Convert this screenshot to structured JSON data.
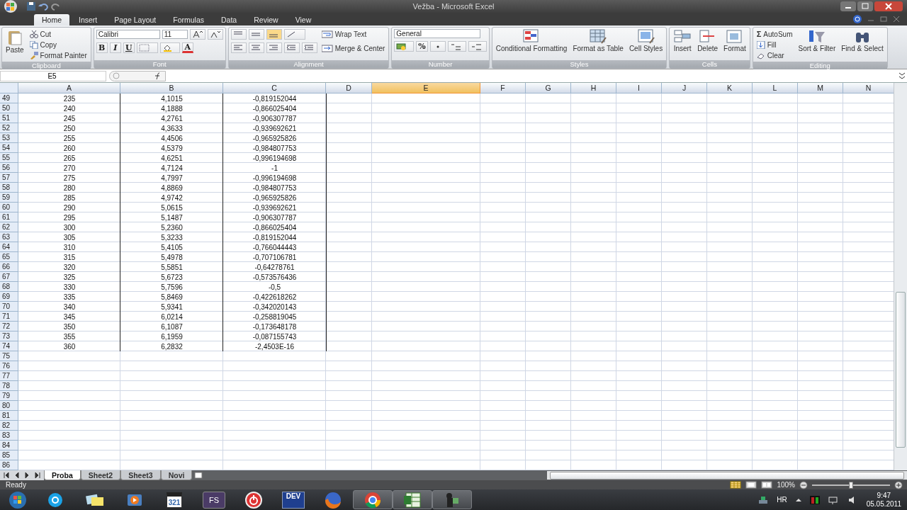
{
  "window": {
    "title": "Vežba - Microsoft Excel"
  },
  "ribbon_tabs": [
    {
      "label": "Home",
      "selected": true
    },
    {
      "label": "Insert",
      "selected": false
    },
    {
      "label": "Page Layout",
      "selected": false
    },
    {
      "label": "Formulas",
      "selected": false
    },
    {
      "label": "Data",
      "selected": false
    },
    {
      "label": "Review",
      "selected": false
    },
    {
      "label": "View",
      "selected": false
    }
  ],
  "ribbon_groups": [
    {
      "kind": "clipboard",
      "label": "Clipboard",
      "controls": [
        {
          "kind": "large",
          "label": "Paste"
        },
        {
          "kind": "small",
          "label": "Cut"
        },
        {
          "kind": "small",
          "label": "Copy"
        },
        {
          "kind": "small",
          "label": "Format Painter"
        }
      ]
    },
    {
      "kind": "font",
      "label": "Font",
      "controls": [
        {
          "kind": "combo",
          "value": "Calibri"
        },
        {
          "kind": "combo",
          "value": "11"
        },
        {
          "kind": "glyph",
          "label": "B"
        },
        {
          "kind": "glyph",
          "label": "I"
        },
        {
          "kind": "glyph",
          "label": "U"
        },
        {
          "kind": "glyph",
          "label": "A"
        }
      ]
    },
    {
      "kind": "alignment",
      "label": "Alignment",
      "controls": [
        {
          "kind": "small",
          "label": "Wrap Text"
        },
        {
          "kind": "small",
          "label": "Merge & Center"
        }
      ]
    },
    {
      "kind": "number",
      "label": "Number",
      "controls": [
        {
          "kind": "combo",
          "value": "General"
        },
        {
          "kind": "glyph",
          "label": "%"
        }
      ]
    },
    {
      "kind": "styles",
      "label": "Styles",
      "controls": [
        {
          "kind": "large",
          "label": "Conditional Formatting"
        },
        {
          "kind": "large",
          "label": "Format as Table"
        },
        {
          "kind": "large",
          "label": "Cell Styles"
        }
      ]
    },
    {
      "kind": "cells",
      "label": "Cells",
      "controls": [
        {
          "kind": "large",
          "label": "Insert"
        },
        {
          "kind": "large",
          "label": "Delete"
        },
        {
          "kind": "large",
          "label": "Format"
        }
      ]
    },
    {
      "kind": "editing",
      "label": "Editing",
      "controls": [
        {
          "kind": "small",
          "label": "AutoSum",
          "symbol": "Σ"
        },
        {
          "kind": "small",
          "label": "Fill"
        },
        {
          "kind": "small",
          "label": "Clear"
        },
        {
          "kind": "large",
          "label": "Sort & Filter"
        },
        {
          "kind": "large",
          "label": "Find & Select"
        }
      ]
    }
  ],
  "formula_bar": {
    "name_box": "E5"
  },
  "sheet": {
    "columns": [
      {
        "label": "A",
        "selected": false
      },
      {
        "label": "B",
        "selected": false
      },
      {
        "label": "C",
        "selected": false
      },
      {
        "label": "D",
        "selected": false
      },
      {
        "label": "E",
        "selected": true
      },
      {
        "label": "F",
        "selected": false
      },
      {
        "label": "G",
        "selected": false
      },
      {
        "label": "H",
        "selected": false
      },
      {
        "label": "I",
        "selected": false
      },
      {
        "label": "J",
        "selected": false
      },
      {
        "label": "K",
        "selected": false
      },
      {
        "label": "L",
        "selected": false
      },
      {
        "label": "M",
        "selected": false
      },
      {
        "label": "N",
        "selected": false
      }
    ],
    "rows": [
      {
        "header": "49",
        "cells": [
          "235",
          "4,1015",
          "-0,819152044"
        ]
      },
      {
        "header": "50",
        "cells": [
          "240",
          "4,1888",
          "-0,866025404"
        ]
      },
      {
        "header": "51",
        "cells": [
          "245",
          "4,2761",
          "-0,906307787"
        ]
      },
      {
        "header": "52",
        "cells": [
          "250",
          "4,3633",
          "-0,939692621"
        ]
      },
      {
        "header": "53",
        "cells": [
          "255",
          "4,4506",
          "-0,965925826"
        ]
      },
      {
        "header": "54",
        "cells": [
          "260",
          "4,5379",
          "-0,984807753"
        ]
      },
      {
        "header": "55",
        "cells": [
          "265",
          "4,6251",
          "-0,996194698"
        ]
      },
      {
        "header": "56",
        "cells": [
          "270",
          "4,7124",
          "-1"
        ]
      },
      {
        "header": "57",
        "cells": [
          "275",
          "4,7997",
          "-0,996194698"
        ]
      },
      {
        "header": "58",
        "cells": [
          "280",
          "4,8869",
          "-0,984807753"
        ]
      },
      {
        "header": "59",
        "cells": [
          "285",
          "4,9742",
          "-0,965925826"
        ]
      },
      {
        "header": "60",
        "cells": [
          "290",
          "5,0615",
          "-0,939692621"
        ]
      },
      {
        "header": "61",
        "cells": [
          "295",
          "5,1487",
          "-0,906307787"
        ]
      },
      {
        "header": "62",
        "cells": [
          "300",
          "5,2360",
          "-0,866025404"
        ]
      },
      {
        "header": "63",
        "cells": [
          "305",
          "5,3233",
          "-0,819152044"
        ]
      },
      {
        "header": "64",
        "cells": [
          "310",
          "5,4105",
          "-0,766044443"
        ]
      },
      {
        "header": "65",
        "cells": [
          "315",
          "5,4978",
          "-0,707106781"
        ]
      },
      {
        "header": "66",
        "cells": [
          "320",
          "5,5851",
          "-0,64278761"
        ]
      },
      {
        "header": "67",
        "cells": [
          "325",
          "5,6723",
          "-0,573576436"
        ]
      },
      {
        "header": "68",
        "cells": [
          "330",
          "5,7596",
          "-0,5"
        ]
      },
      {
        "header": "69",
        "cells": [
          "335",
          "5,8469",
          "-0,422618262"
        ]
      },
      {
        "header": "70",
        "cells": [
          "340",
          "5,9341",
          "-0,342020143"
        ]
      },
      {
        "header": "71",
        "cells": [
          "345",
          "6,0214",
          "-0,258819045"
        ]
      },
      {
        "header": "72",
        "cells": [
          "350",
          "6,1087",
          "-0,173648178"
        ]
      },
      {
        "header": "73",
        "cells": [
          "355",
          "6,1959",
          "-0,087155743"
        ]
      },
      {
        "header": "74",
        "cells": [
          "360",
          "6,2832",
          "-2,4503E-16"
        ]
      },
      {
        "header": "75"
      },
      {
        "header": "76"
      },
      {
        "header": "77"
      },
      {
        "header": "78"
      },
      {
        "header": "79"
      },
      {
        "header": "80"
      },
      {
        "header": "81"
      },
      {
        "header": "82"
      },
      {
        "header": "83"
      },
      {
        "header": "84"
      },
      {
        "header": "85"
      },
      {
        "header": "86"
      }
    ]
  },
  "sheet_tabs": [
    {
      "label": "Proba",
      "selected": true
    },
    {
      "label": "Sheet2",
      "selected": false
    },
    {
      "label": "Sheet3",
      "selected": false
    },
    {
      "label": "Novi",
      "selected": false
    }
  ],
  "status_bar": {
    "status": "Ready",
    "zoom": "100%",
    "zoom_slider": {
      "level": 0.5
    }
  },
  "taskbar": {
    "apps": [
      {
        "kind": "skype",
        "running": false
      },
      {
        "kind": "notes",
        "running": false
      },
      {
        "kind": "player",
        "running": false
      },
      {
        "kind": "clapper",
        "label": "321",
        "running": false
      },
      {
        "kind": "tile",
        "label": "FS",
        "running": false
      },
      {
        "kind": "power",
        "running": false
      },
      {
        "kind": "dev",
        "label": "DEV",
        "running": false
      },
      {
        "kind": "firefox",
        "running": false
      },
      {
        "kind": "chrome",
        "running": true
      },
      {
        "kind": "excel",
        "running": true
      },
      {
        "kind": "camera",
        "running": true
      }
    ],
    "language": "HR",
    "time": "9:47",
    "date": "05.05.2011"
  }
}
